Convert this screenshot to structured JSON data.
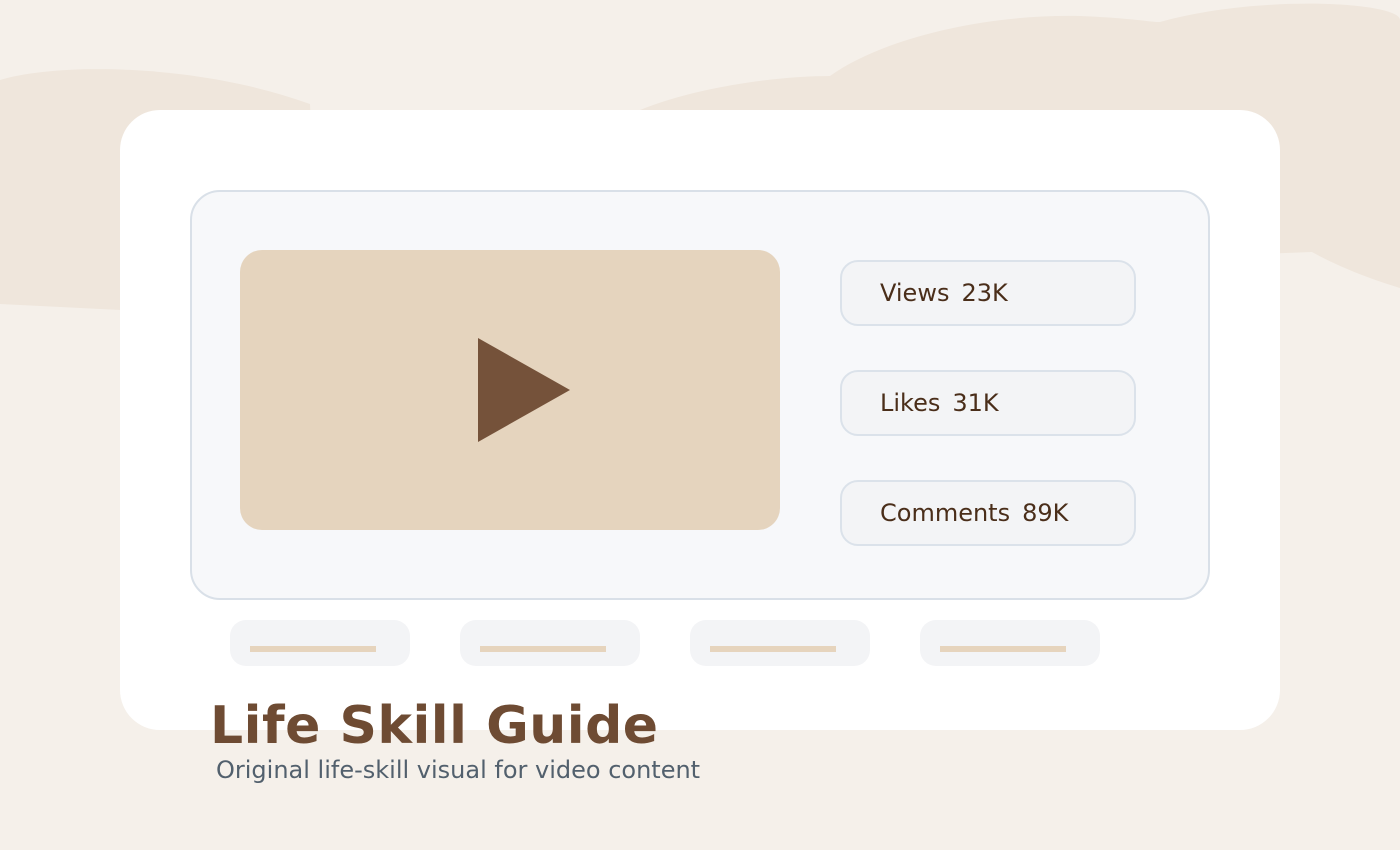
{
  "colors": {
    "page_background": "#f5f0ea",
    "background_blob": "#efe6dc",
    "card": "#ffffff",
    "panel": "#f7f8fa",
    "panel_border": "#d9e0e8",
    "video_placeholder": "#e5d4be",
    "play_icon": "#75523a",
    "stat_text": "#4a2e1a",
    "title": "#6e4b33",
    "subtitle": "#52606d"
  },
  "video": {
    "icon": "play-icon"
  },
  "stats": [
    {
      "label": "Views",
      "value": "23K"
    },
    {
      "label": "Likes",
      "value": "31K"
    },
    {
      "label": "Comments",
      "value": "89K"
    }
  ],
  "title": "Life Skill Guide",
  "subtitle": "Original life-skill visual for video content"
}
